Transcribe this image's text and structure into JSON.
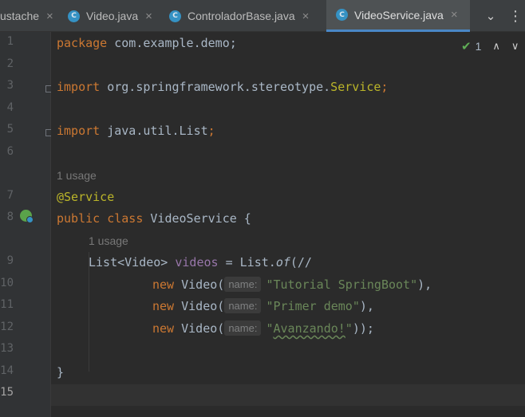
{
  "tabs": [
    {
      "label": "ustache",
      "close": "×",
      "active": false,
      "icon": "none"
    },
    {
      "label": "Video.java",
      "close": "×",
      "active": false,
      "icon": "java-class-icon"
    },
    {
      "label": "ControladorBase.java",
      "close": "×",
      "active": false,
      "icon": "java-class-icon"
    },
    {
      "label": "VideoService.java",
      "close": "×",
      "active": true,
      "icon": "java-class-icon"
    }
  ],
  "tab_actions": {
    "menu": "⌄",
    "more": "⋮"
  },
  "inspection": {
    "check": "✔",
    "count": "1",
    "up": "∧",
    "down": "∨"
  },
  "line_numbers": [
    "1",
    "2",
    "3",
    "4",
    "5",
    "6",
    "7",
    "8",
    "9",
    "10",
    "11",
    "12",
    "13",
    "14",
    "15"
  ],
  "code": {
    "line1": {
      "kw": "package",
      "rest": " com.example.demo;"
    },
    "line3": {
      "kw": "import",
      "rest": " org.springframework.stereotype.",
      "cls": "Service",
      "end": ";"
    },
    "line5": {
      "kw": "import",
      "rest": " java.util.List",
      "end": ";"
    },
    "usage1": "1 usage",
    "line7": {
      "ann": "@Service"
    },
    "line8": {
      "kw": "public class",
      "rest": " VideoService {"
    },
    "usage2": "1 usage",
    "line9": {
      "type": "List<Video> ",
      "field": "videos",
      "eq": " = List.",
      "method": "of",
      "rest": "(//"
    },
    "line10": {
      "kw": "new",
      "cls": " Video(",
      "param": "name:",
      "str": "\"Tutorial SpringBoot\"",
      "end": "),"
    },
    "line11": {
      "kw": "new",
      "cls": " Video(",
      "param": "name:",
      "str": "\"Primer demo\"",
      "end": "),"
    },
    "line12": {
      "kw": "new",
      "cls": " Video(",
      "param": "name:",
      "str_q": "\"",
      "str": "Avanzando!",
      "str_q2": "\"",
      "end": "));"
    },
    "line14": {
      "brace": "}"
    }
  },
  "colors": {
    "background": "#2b2b2b",
    "keyword": "#cc7832",
    "annotation": "#bbb529",
    "string": "#6a8759",
    "field": "#9876aa",
    "text": "#a9b7c6",
    "active_tab_underline": "#4a88c7"
  }
}
